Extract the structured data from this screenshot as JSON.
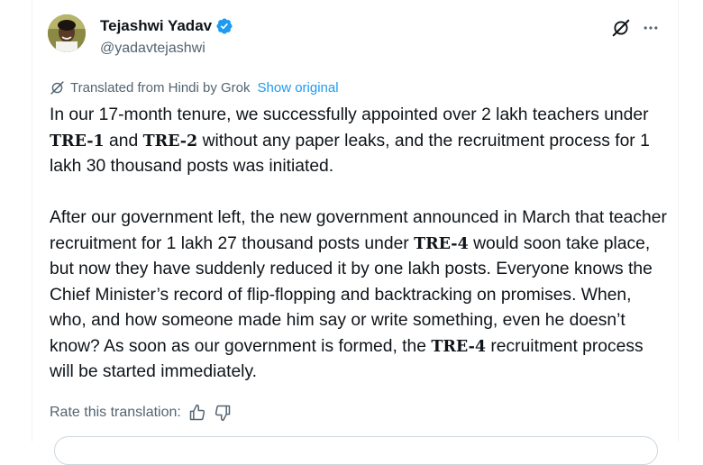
{
  "author": {
    "name": "Tejashwi Yadav",
    "handle": "@yadavtejashwi",
    "verified_color": "#1d9bf0"
  },
  "header_icons": [
    "grok-icon",
    "more-options-icon"
  ],
  "translation": {
    "notice": "Translated from Hindi by Grok",
    "show_original": "Show original",
    "notice_icon": "grok-icon"
  },
  "tweet": {
    "p1_a": "In our 17-month tenure, we successfully appointed over 2 lakh teachers under ",
    "tre1": "TRE-1",
    "p1_b": " and ",
    "tre2": "TRE-2",
    "p1_c": " without any paper leaks, and the recruitment process for 1 lakh 30 thousand posts was initiated.",
    "p2_a": "After our government left, the new government announced in March that teacher recruitment for 1 lakh 27 thousand posts under ",
    "tre4a": "TRE-4",
    "p2_b": " would soon take place, but now they have suddenly reduced it by one lakh posts. Everyone knows the Chief Minister’s record of flip-flopping and backtracking on promises. When, who, and how someone made him say or write something, even he doesn’t know? As soon as our government is formed, the ",
    "tre4b": "TRE-4",
    "p2_c": " recruitment process will be started immediately."
  },
  "rating": {
    "label": "Rate this translation:",
    "icons": [
      "thumbs-up-icon",
      "thumbs-down-icon"
    ]
  },
  "colors": {
    "link": "#1d9bf0",
    "secondary_text": "#536471",
    "primary_text": "#0f1419"
  }
}
